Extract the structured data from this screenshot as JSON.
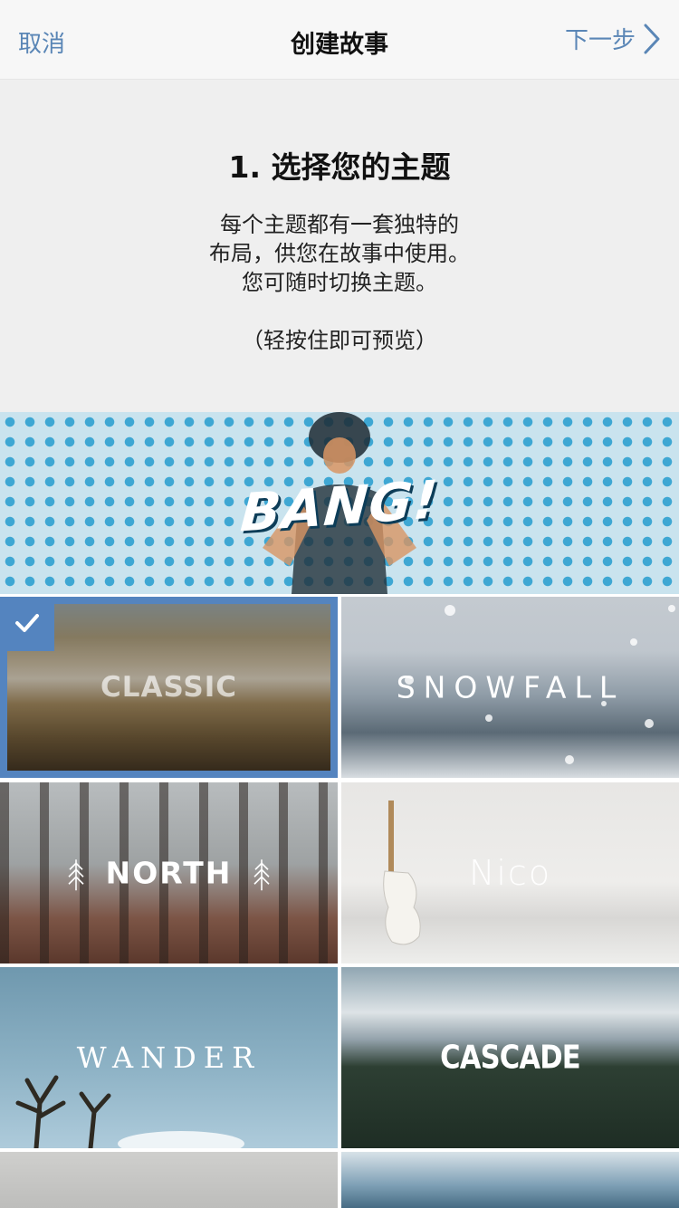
{
  "nav": {
    "cancel_label": "取消",
    "title": "创建故事",
    "next_label": "下一步"
  },
  "intro": {
    "step_title": "1. 选择您的主题",
    "description_lines": [
      "每个主题都有一套独特的",
      "布局，供您在故事中使用。",
      "您可随时切换主题。"
    ],
    "hint": "（轻按住即可预览）"
  },
  "banner": {
    "label": "BANG!"
  },
  "themes": [
    {
      "label": "CLASSIC",
      "selected": true
    },
    {
      "label": "SNOWFALL",
      "selected": false
    },
    {
      "label": "NORTH",
      "selected": false
    },
    {
      "label": "Nico",
      "selected": false
    },
    {
      "label": "WANDER",
      "selected": false
    },
    {
      "label": "CASCADE",
      "selected": false
    }
  ],
  "colors": {
    "accent": "#5484bf",
    "link": "#5a86b6",
    "intro_bg": "#efefef"
  },
  "icons": {
    "next": "chevron-right-icon",
    "selected": "checkmark-icon",
    "north_decoration": "pine-tree-icon"
  }
}
